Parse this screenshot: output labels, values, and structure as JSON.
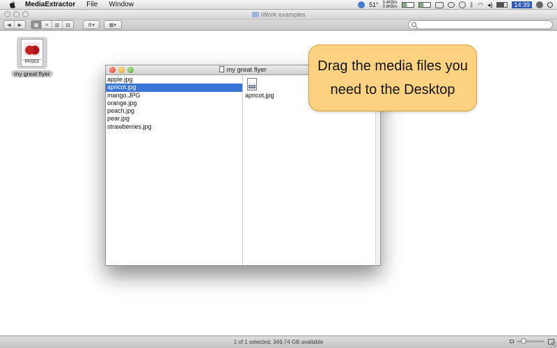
{
  "menubar": {
    "app_name": "MediaExtractor",
    "items": [
      "File",
      "Window"
    ],
    "status": {
      "temperature": "51°",
      "net_up": "0.4KB/s",
      "net_down": "0.8KB/s",
      "clock": "14:39"
    }
  },
  "finder": {
    "title": "iWork examples",
    "search_placeholder": "",
    "status_text": "1 of 1 selected, 346,74 GB available",
    "desktop_item": "my great flyer",
    "desktop_item_badge": "PAGES"
  },
  "media_window": {
    "title": "my great flyer",
    "files": [
      "apple.jpg",
      "apricot.jpg",
      "mango.JPG",
      "orange.jpg",
      "peach.jpg",
      "pear.jpg",
      "strawberries.jpg"
    ],
    "selected_index": 1,
    "preview_name": "apricot.jpg",
    "preview_badge": "JPEG"
  },
  "callout": {
    "text": "Drag the media files you need to the Desktop"
  },
  "colors": {
    "selection": "#3875d7",
    "callout_fill": "#fdd280",
    "callout_border": "#e09a2c"
  }
}
